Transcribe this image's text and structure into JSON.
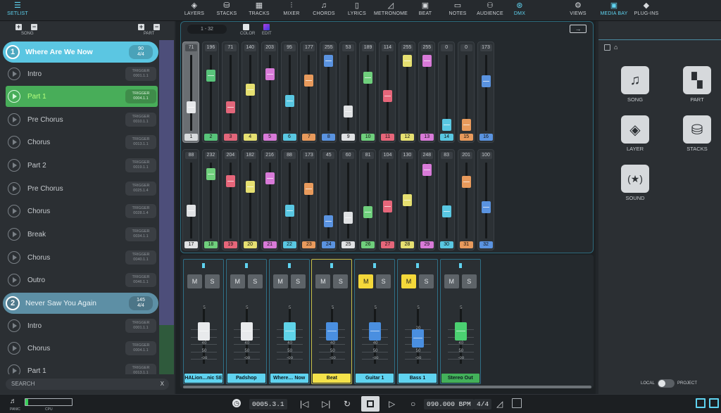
{
  "top_nav": {
    "setlist": "SETLIST",
    "layers": "LAYERS",
    "stacks": "STACKS",
    "tracks": "TRACKS",
    "mixer": "MIXER",
    "chords": "CHORDS",
    "lyrics": "LYRICS",
    "metronome": "METRONOME",
    "beat": "BEAT",
    "notes": "NOTES",
    "audience": "AUDIENCE",
    "dmx": "DMX",
    "views": "VIEWS",
    "media_bay": "MEDIA BAY",
    "plug_ins": "PLUG-INS"
  },
  "setlist": {
    "song_label": "SONG",
    "part_label": "PART",
    "songs": [
      {
        "number": "1",
        "name": "Where Are We Now",
        "tempo": "90",
        "signature": "4/4"
      },
      {
        "number": "2",
        "name": "Never Saw You Again",
        "tempo": "145",
        "signature": "4/4"
      }
    ],
    "parts": [
      {
        "name": "Intro",
        "trigger": "TRIGGER",
        "pos": "0001.1.1"
      },
      {
        "name": "Part 1",
        "trigger": "TRIGGER",
        "pos": "0004.1.1"
      },
      {
        "name": "Pre Chorus",
        "trigger": "TRIGGER",
        "pos": "0010.1.1"
      },
      {
        "name": "Chorus",
        "trigger": "TRIGGER",
        "pos": "0013.1.1"
      },
      {
        "name": "Part 2",
        "trigger": "TRIGGER",
        "pos": "0019.1.1"
      },
      {
        "name": "Pre Chorus",
        "trigger": "TRIGGER",
        "pos": "0025.1.4"
      },
      {
        "name": "Chorus",
        "trigger": "TRIGGER",
        "pos": "0028.1.4"
      },
      {
        "name": "Break",
        "trigger": "TRIGGER",
        "pos": "0034.1.1"
      },
      {
        "name": "Chorus",
        "trigger": "TRIGGER",
        "pos": "0040.1.1"
      },
      {
        "name": "Outro",
        "trigger": "TRIGGER",
        "pos": "0046.1.1"
      }
    ],
    "parts2": [
      {
        "name": "Intro",
        "trigger": "TRIGGER",
        "pos": "0001.1.1"
      },
      {
        "name": "Chorus",
        "trigger": "TRIGGER",
        "pos": "0004.1.1"
      },
      {
        "name": "Part 1",
        "trigger": "TRIGGER",
        "pos": "0013.1.1"
      }
    ],
    "search_placeholder": "SEARCH",
    "search_clear": "X"
  },
  "dmx": {
    "range": "1 - 32",
    "color_label": "COLOR",
    "edit_label": "EDIT",
    "arrow": "→",
    "row1": [
      {
        "n": "1",
        "v": "71",
        "c": "#d8dbdd"
      },
      {
        "n": "2",
        "v": "196",
        "c": "#58c47a"
      },
      {
        "n": "3",
        "v": "71",
        "c": "#e2667a"
      },
      {
        "n": "4",
        "v": "140",
        "c": "#e6e071"
      },
      {
        "n": "5",
        "v": "203",
        "c": "#d87ad8"
      },
      {
        "n": "6",
        "v": "95",
        "c": "#59c7e2"
      },
      {
        "n": "7",
        "v": "177",
        "c": "#e89a5c"
      },
      {
        "n": "8",
        "v": "255",
        "c": "#5a93e0"
      },
      {
        "n": "9",
        "v": "53",
        "c": "#e0e2e4"
      },
      {
        "n": "10",
        "v": "189",
        "c": "#6fcf7c"
      },
      {
        "n": "11",
        "v": "114",
        "c": "#e6667a"
      },
      {
        "n": "12",
        "v": "255",
        "c": "#e6e071"
      },
      {
        "n": "13",
        "v": "255",
        "c": "#d87ad8"
      },
      {
        "n": "14",
        "v": "0",
        "c": "#59c7e2"
      },
      {
        "n": "15",
        "v": "0",
        "c": "#e89a5c"
      },
      {
        "n": "16",
        "v": "173",
        "c": "#5a93e0"
      }
    ],
    "row2": [
      {
        "n": "17",
        "v": "88",
        "c": "#e0e2e4"
      },
      {
        "n": "18",
        "v": "232",
        "c": "#6fcf7c"
      },
      {
        "n": "19",
        "v": "204",
        "c": "#e6667a"
      },
      {
        "n": "20",
        "v": "182",
        "c": "#e6e071"
      },
      {
        "n": "21",
        "v": "216",
        "c": "#d87ad8"
      },
      {
        "n": "22",
        "v": "88",
        "c": "#59c7e2"
      },
      {
        "n": "23",
        "v": "173",
        "c": "#e89a5c"
      },
      {
        "n": "24",
        "v": "45",
        "c": "#5a93e0"
      },
      {
        "n": "25",
        "v": "60",
        "c": "#e0e2e4"
      },
      {
        "n": "26",
        "v": "81",
        "c": "#6fcf7c"
      },
      {
        "n": "27",
        "v": "104",
        "c": "#e6667a"
      },
      {
        "n": "28",
        "v": "130",
        "c": "#e6e071"
      },
      {
        "n": "29",
        "v": "248",
        "c": "#d87ad8"
      },
      {
        "n": "30",
        "v": "83",
        "c": "#59c7e2"
      },
      {
        "n": "31",
        "v": "201",
        "c": "#e89a5c"
      },
      {
        "n": "32",
        "v": "100",
        "c": "#5a93e0"
      }
    ]
  },
  "mixer": {
    "strips": [
      {
        "name": "HALion…nic SE",
        "m": "M",
        "s": "S",
        "mute": false,
        "color": "#e8eaec",
        "style": "blue",
        "level": 0.72
      },
      {
        "name": "Padshop",
        "m": "M",
        "s": "S",
        "mute": false,
        "color": "#e8eaec",
        "style": "blue",
        "level": 0.72
      },
      {
        "name": "Where… Now",
        "m": "M",
        "s": "S",
        "mute": false,
        "color": "#5fd3e8",
        "style": "blue",
        "level": 0.72
      },
      {
        "name": "Beat",
        "m": "M",
        "s": "S",
        "mute": false,
        "color": "#4a8fe0",
        "style": "yel",
        "level": 0.72
      },
      {
        "name": "Guitar 1",
        "m": "M",
        "s": "S",
        "mute": true,
        "color": "#4a8fe0",
        "style": "blue",
        "level": 0.72
      },
      {
        "name": "Bass 1",
        "m": "M",
        "s": "S",
        "mute": true,
        "color": "#4a8fe0",
        "style": "blue",
        "level": 0.6
      },
      {
        "name": "Stereo Out",
        "m": "M",
        "s": "S",
        "mute": false,
        "color": "#4bd071",
        "style": "green",
        "level": 0.72
      }
    ],
    "scale_top": "5",
    "scale": [
      "20",
      "30",
      "40",
      "50",
      "-oo"
    ]
  },
  "media_bay": {
    "tiles": [
      {
        "label": "SONG",
        "icon": "music-note-icon"
      },
      {
        "label": "PART",
        "icon": "part-grid-icon"
      },
      {
        "label": "LAYER",
        "icon": "layers-icon"
      },
      {
        "label": "STACKS",
        "icon": "stacks-icon"
      },
      {
        "label": "SOUND",
        "icon": "sound-icon"
      }
    ],
    "local": "LOCAL",
    "project": "PROJECT"
  },
  "transport": {
    "panic": "PANIC",
    "cpu": "CPU",
    "position": "0005.3.1",
    "tempo": "090.000",
    "bpm": "BPM",
    "signature": "4/4"
  }
}
